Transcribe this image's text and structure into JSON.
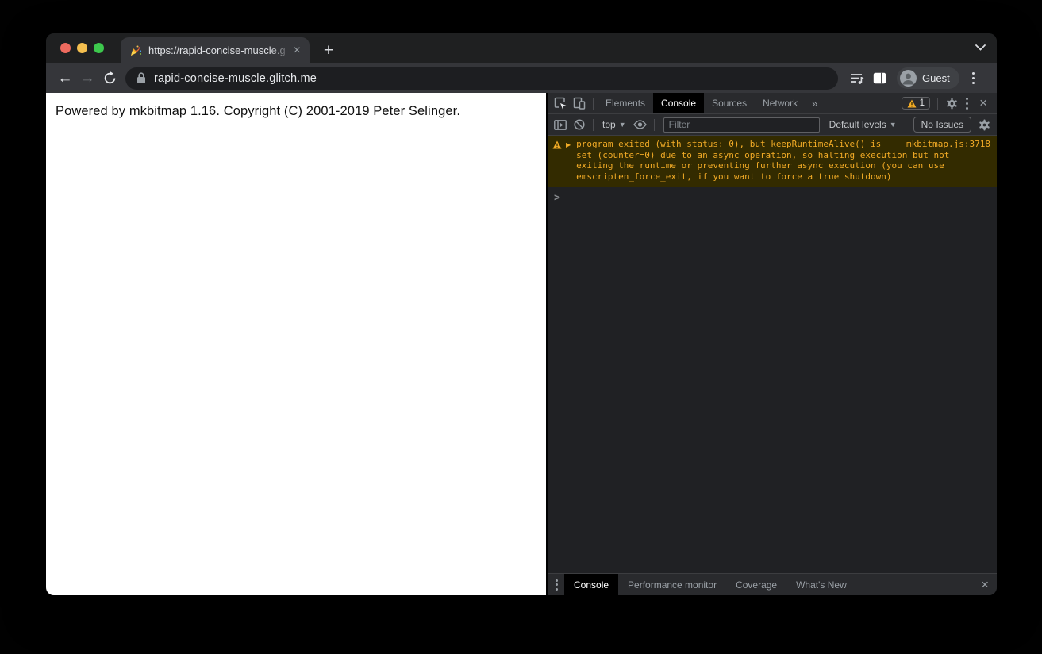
{
  "browser": {
    "tab_title": "https://rapid-concise-muscle.g",
    "tab_close": "×",
    "new_tab_label": "+",
    "url": "rapid-concise-muscle.glitch.me",
    "back": "←",
    "forward": "→",
    "profile_label": "Guest"
  },
  "page": {
    "body_text": "Powered by mkbitmap 1.16. Copyright (C) 2001-2019 Peter Selinger."
  },
  "devtools": {
    "tabs": [
      "Elements",
      "Console",
      "Sources",
      "Network"
    ],
    "active_tab": "Console",
    "more_tabs": "»",
    "warning_count": "1",
    "close": "×",
    "toolbar": {
      "context_label": "top",
      "caret": "▼",
      "filter_placeholder": "Filter",
      "levels_label": "Default levels",
      "issues_label": "No Issues"
    },
    "console": {
      "expand": "▶",
      "warning_text": "program exited (with status: 0), but keepRuntimeAlive() is\nset (counter=0) due to an async operation, so halting execution but not\nexiting the runtime or preventing further async execution (you can use\nemscripten_force_exit, if you want to force a true shutdown)",
      "source_link": "mkbitmap.js:3718",
      "prompt": ">"
    },
    "drawer": {
      "tabs": [
        "Console",
        "Performance monitor",
        "Coverage",
        "What's New"
      ],
      "active_tab": "Console",
      "close": "×"
    }
  },
  "colors": {
    "warning_text": "#f2ab26",
    "warning_bg": "#332b00",
    "devtools_bg": "#202124",
    "toolbar_bg": "#292a2d",
    "active_tab_bg": "#000000",
    "traffic_red": "#ed6a5e",
    "traffic_yellow": "#f4bf4f",
    "traffic_green": "#3dc84d"
  }
}
